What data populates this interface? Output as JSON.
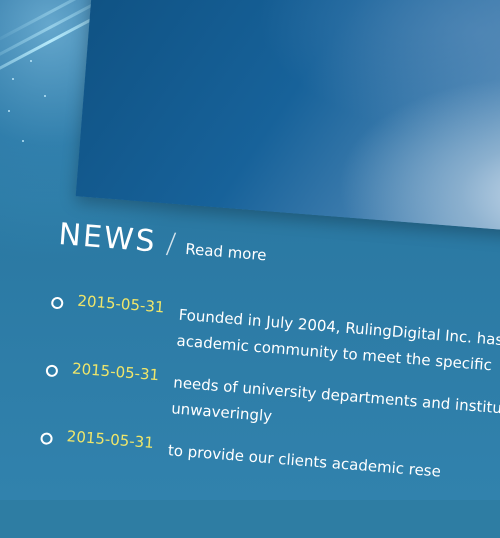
{
  "colors": {
    "background": "#2e7da3",
    "date_accent": "#f0e66a",
    "text": "#ffffff"
  },
  "news": {
    "title": "NEWS",
    "separator": "/",
    "read_more_label": "Read more",
    "items": [
      {
        "date": "2015-05-31",
        "text_line1": "Founded in July 2004, RulingDigital Inc. has",
        "text_line2": "academic community to meet the specific"
      },
      {
        "date": "2015-05-31",
        "text_line1": "needs of university departments and institute",
        "text_line2": "unwaveringly"
      },
      {
        "date": "2015-05-31",
        "text_line1": "to provide our clients academic rese",
        "text_line2": ""
      }
    ]
  }
}
